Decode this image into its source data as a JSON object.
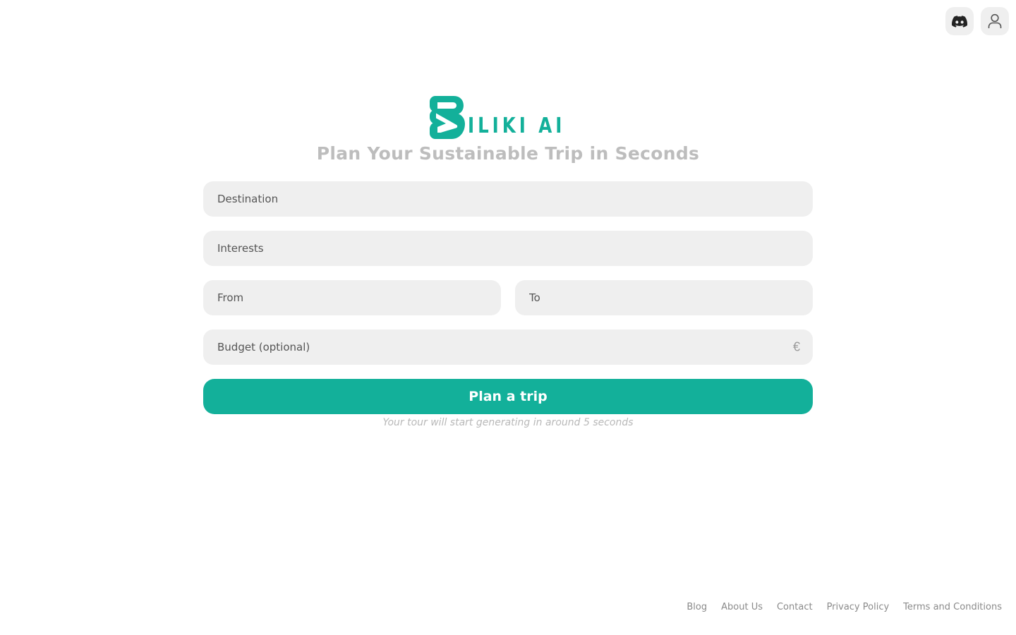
{
  "header": {
    "discord_icon": "discord-icon",
    "user_icon": "user-icon"
  },
  "brand": {
    "logo_text": "ILIKI AI",
    "accent_color": "#13b09a"
  },
  "subtitle": "Plan Your Sustainable Trip in Seconds",
  "form": {
    "destination_placeholder": "Destination",
    "interests_placeholder": "Interests",
    "from_placeholder": "From",
    "to_placeholder": "To",
    "budget_placeholder": "Budget (optional)",
    "currency_symbol": "€",
    "submit_label": "Plan a trip",
    "note": "Your tour will start generating in around 5 seconds"
  },
  "footer": {
    "links": [
      "Blog",
      "About Us",
      "Contact",
      "Privacy Policy",
      "Terms and Conditions"
    ]
  }
}
